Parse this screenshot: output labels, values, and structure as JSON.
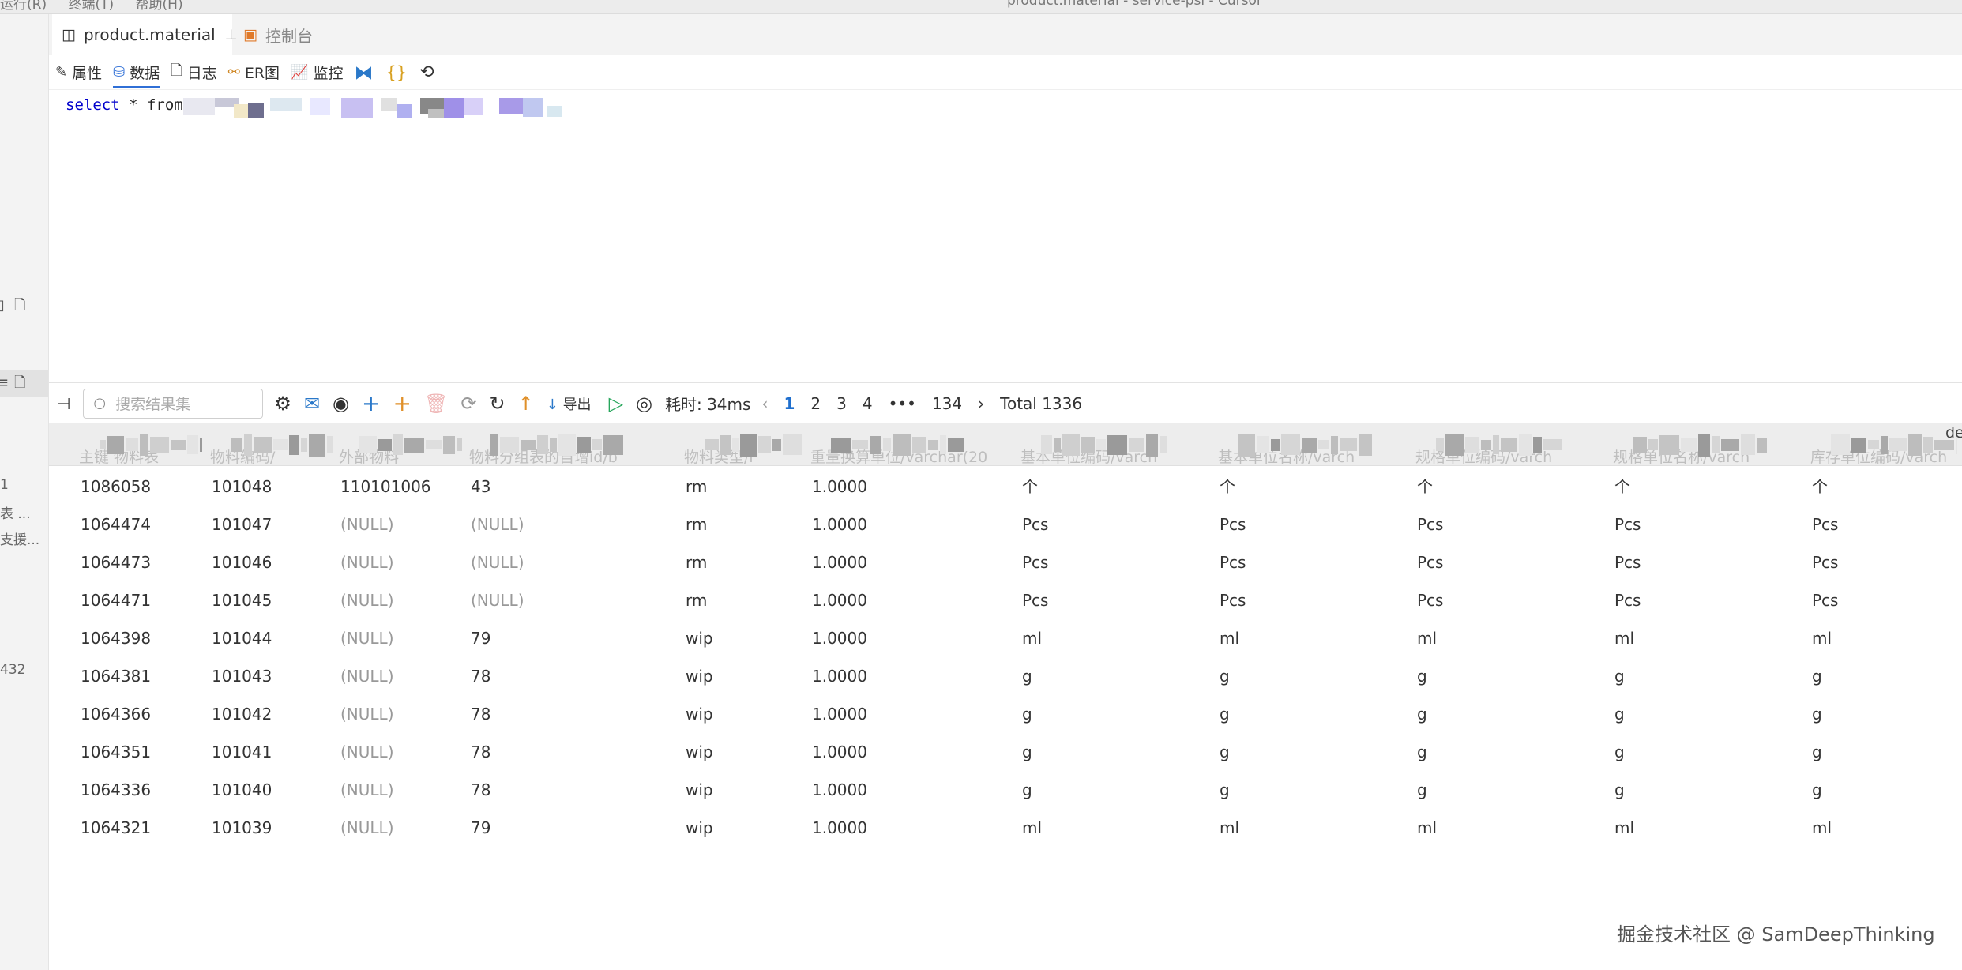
{
  "titlebar": {
    "menu": [
      "运行(R)",
      "终端(T)",
      "帮助(H)"
    ],
    "window_title": "product.material - service-psi - Cursor"
  },
  "gutter": {
    "texts": [
      "1",
      "表 ...",
      "支援...",
      "432"
    ]
  },
  "tabs": [
    {
      "label": "product.material",
      "icon": "table-icon",
      "pinned": true
    },
    {
      "label": "控制台",
      "icon": "console-icon"
    }
  ],
  "subbar": {
    "items": [
      "属性",
      "数据",
      "日志",
      "ER图",
      "监控"
    ],
    "active": "数据"
  },
  "editor": {
    "sql_keyword": "select",
    "sql_rest": " * from"
  },
  "results_toolbar": {
    "search_placeholder": "搜索结果集",
    "export_label": "导出",
    "timing": "耗时: 34ms",
    "pages": [
      "1",
      "2",
      "3",
      "4",
      "•••",
      "134"
    ],
    "current_page": "1",
    "total": "Total 1336"
  },
  "table": {
    "header_visible_fragments": [
      "主键 物料表",
      "物料编码/",
      "外部物料",
      "物料分组表的自增id/b",
      "物料类型/r",
      "重量换算单位/varchar(20",
      "基本单位编码/varch",
      "基本单位名称/varch",
      "规格单位编码/varch",
      "规格单位名称/varch",
      "库存单位编码/varch"
    ],
    "header_cut_text": "de",
    "rows": [
      [
        "1086058",
        "101048",
        "110101006",
        "43",
        "rm",
        "1.0000",
        "个",
        "个",
        "个",
        "个",
        "个"
      ],
      [
        "1064474",
        "101047",
        "(NULL)",
        "(NULL)",
        "rm",
        "1.0000",
        "Pcs",
        "Pcs",
        "Pcs",
        "Pcs",
        "Pcs"
      ],
      [
        "1064473",
        "101046",
        "(NULL)",
        "(NULL)",
        "rm",
        "1.0000",
        "Pcs",
        "Pcs",
        "Pcs",
        "Pcs",
        "Pcs"
      ],
      [
        "1064471",
        "101045",
        "(NULL)",
        "(NULL)",
        "rm",
        "1.0000",
        "Pcs",
        "Pcs",
        "Pcs",
        "Pcs",
        "Pcs"
      ],
      [
        "1064398",
        "101044",
        "(NULL)",
        "79",
        "wip",
        "1.0000",
        "ml",
        "ml",
        "ml",
        "ml",
        "ml"
      ],
      [
        "1064381",
        "101043",
        "(NULL)",
        "78",
        "wip",
        "1.0000",
        "g",
        "g",
        "g",
        "g",
        "g"
      ],
      [
        "1064366",
        "101042",
        "(NULL)",
        "78",
        "wip",
        "1.0000",
        "g",
        "g",
        "g",
        "g",
        "g"
      ],
      [
        "1064351",
        "101041",
        "(NULL)",
        "78",
        "wip",
        "1.0000",
        "g",
        "g",
        "g",
        "g",
        "g"
      ],
      [
        "1064336",
        "101040",
        "(NULL)",
        "78",
        "wip",
        "1.0000",
        "g",
        "g",
        "g",
        "g",
        "g"
      ],
      [
        "1064321",
        "101039",
        "(NULL)",
        "79",
        "wip",
        "1.0000",
        "ml",
        "ml",
        "ml",
        "ml",
        "ml"
      ]
    ]
  },
  "watermark": "掘金技术社区 @ SamDeepThinking",
  "colors": {
    "accent": "#2f6fd6",
    "page_current": "#1f6fce",
    "null_text": "#999999",
    "run_green": "#27a65c"
  }
}
